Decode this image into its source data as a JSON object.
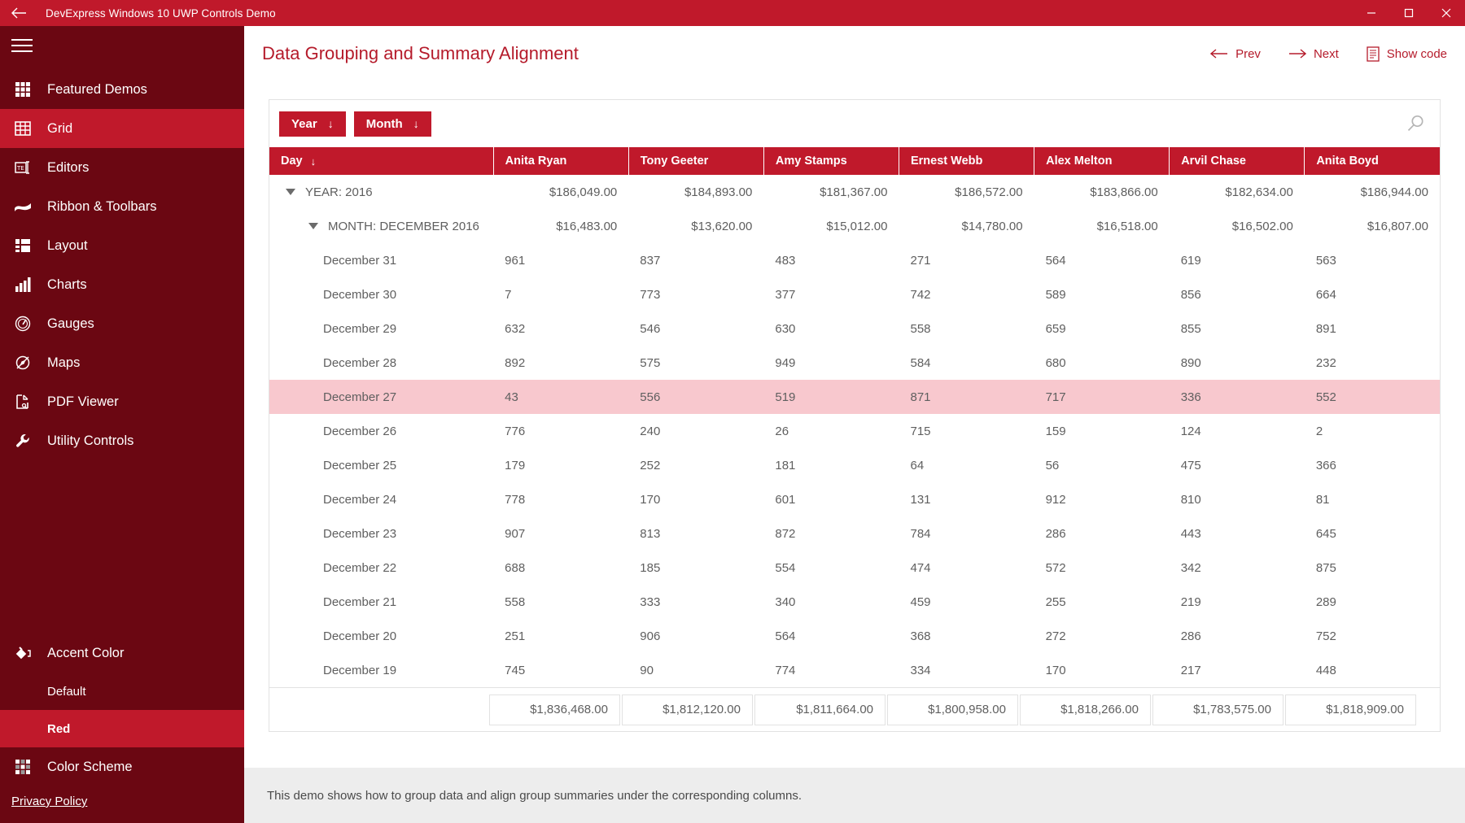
{
  "window": {
    "title": "DevExpress Windows 10 UWP Controls Demo",
    "back_icon": "back-arrow-icon",
    "minimize_label": "—",
    "maximize_label": "□",
    "close_label": "✕"
  },
  "sidebar": {
    "menu_icon": "hamburger-icon",
    "items": [
      {
        "label": "Featured Demos",
        "icon": "grid-apps-icon",
        "active": false
      },
      {
        "label": "Grid",
        "icon": "table-icon",
        "active": true
      },
      {
        "label": "Editors",
        "icon": "textbox-icon",
        "active": false
      },
      {
        "label": "Ribbon & Toolbars",
        "icon": "ribbon-icon",
        "active": false
      },
      {
        "label": "Layout",
        "icon": "layout-icon",
        "active": false
      },
      {
        "label": "Charts",
        "icon": "bar-chart-icon",
        "active": false
      },
      {
        "label": "Gauges",
        "icon": "gauge-icon",
        "active": false
      },
      {
        "label": "Maps",
        "icon": "compass-icon",
        "active": false
      },
      {
        "label": "PDF Viewer",
        "icon": "pdf-icon",
        "active": false
      },
      {
        "label": "Utility Controls",
        "icon": "wrench-icon",
        "active": false
      }
    ],
    "accent": {
      "label": "Accent Color",
      "icon": "paint-bucket-icon",
      "options": [
        {
          "label": "Default",
          "active": false
        },
        {
          "label": "Red",
          "active": true
        }
      ]
    },
    "color_scheme": {
      "label": "Color Scheme",
      "icon": "color-palette-icon"
    },
    "privacy": "Privacy Policy"
  },
  "header": {
    "title": "Data Grouping and Summary Alignment",
    "actions": [
      {
        "label": "Prev",
        "icon": "arrow-left-icon"
      },
      {
        "label": "Next",
        "icon": "arrow-right-icon"
      },
      {
        "label": "Show code",
        "icon": "document-icon"
      }
    ]
  },
  "grid": {
    "group_chips": [
      {
        "label": "Year",
        "sort": "↓"
      },
      {
        "label": "Month",
        "sort": "↓"
      }
    ],
    "search_icon": "search-icon",
    "columns": [
      {
        "label": "Day",
        "sort": "↓"
      },
      {
        "label": "Anita Ryan",
        "sort": ""
      },
      {
        "label": "Tony Geeter",
        "sort": ""
      },
      {
        "label": "Amy Stamps",
        "sort": ""
      },
      {
        "label": "Ernest Webb",
        "sort": ""
      },
      {
        "label": "Alex Melton",
        "sort": ""
      },
      {
        "label": "Arvil Chase",
        "sort": ""
      },
      {
        "label": "Anita Boyd",
        "sort": ""
      }
    ],
    "group_year": {
      "label": "YEAR: 2016",
      "values": [
        "$186,049.00",
        "$184,893.00",
        "$181,367.00",
        "$186,572.00",
        "$183,866.00",
        "$182,634.00",
        "$186,944.00"
      ]
    },
    "group_month": {
      "label": "MONTH: DECEMBER 2016",
      "values": [
        "$16,483.00",
        "$13,620.00",
        "$15,012.00",
        "$14,780.00",
        "$16,518.00",
        "$16,502.00",
        "$16,807.00"
      ]
    },
    "rows": [
      {
        "day": "December 31",
        "values": [
          "961",
          "837",
          "483",
          "271",
          "564",
          "619",
          "563"
        ],
        "selected": false
      },
      {
        "day": "December 30",
        "values": [
          "7",
          "773",
          "377",
          "742",
          "589",
          "856",
          "664"
        ],
        "selected": false
      },
      {
        "day": "December 29",
        "values": [
          "632",
          "546",
          "630",
          "558",
          "659",
          "855",
          "891"
        ],
        "selected": false
      },
      {
        "day": "December 28",
        "values": [
          "892",
          "575",
          "949",
          "584",
          "680",
          "890",
          "232"
        ],
        "selected": false
      },
      {
        "day": "December 27",
        "values": [
          "43",
          "556",
          "519",
          "871",
          "717",
          "336",
          "552"
        ],
        "selected": true
      },
      {
        "day": "December 26",
        "values": [
          "776",
          "240",
          "26",
          "715",
          "159",
          "124",
          "2"
        ],
        "selected": false
      },
      {
        "day": "December 25",
        "values": [
          "179",
          "252",
          "181",
          "64",
          "56",
          "475",
          "366"
        ],
        "selected": false
      },
      {
        "day": "December 24",
        "values": [
          "778",
          "170",
          "601",
          "131",
          "912",
          "810",
          "81"
        ],
        "selected": false
      },
      {
        "day": "December 23",
        "values": [
          "907",
          "813",
          "872",
          "784",
          "286",
          "443",
          "645"
        ],
        "selected": false
      },
      {
        "day": "December 22",
        "values": [
          "688",
          "185",
          "554",
          "474",
          "572",
          "342",
          "875"
        ],
        "selected": false
      },
      {
        "day": "December 21",
        "values": [
          "558",
          "333",
          "340",
          "459",
          "255",
          "219",
          "289"
        ],
        "selected": false
      },
      {
        "day": "December 20",
        "values": [
          "251",
          "906",
          "564",
          "368",
          "272",
          "286",
          "752"
        ],
        "selected": false
      },
      {
        "day": "December 19",
        "values": [
          "745",
          "90",
          "774",
          "334",
          "170",
          "217",
          "448"
        ],
        "selected": false
      }
    ],
    "totals": [
      "$1,836,468.00",
      "$1,812,120.00",
      "$1,811,664.00",
      "$1,800,958.00",
      "$1,818,266.00",
      "$1,783,575.00",
      "$1,818,909.00"
    ]
  },
  "description": "This demo shows how to group data and align group summaries under the corresponding columns.",
  "colors": {
    "accent": "#C0192B",
    "sidebar": "#6B0712",
    "title_text": "#B51B2B",
    "selected_row": "#F8C8CE",
    "description_bg": "#EDEDED"
  }
}
